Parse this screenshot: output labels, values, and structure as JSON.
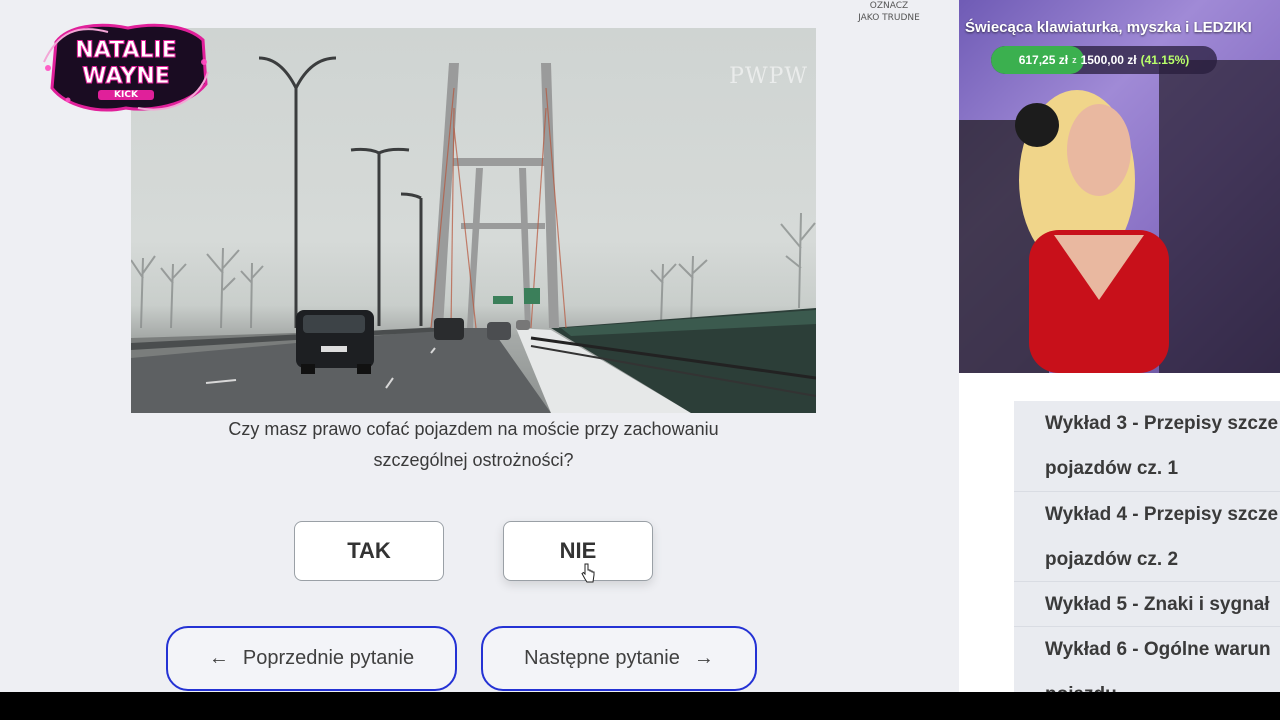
{
  "brand": {
    "name_line1": "NATALIE",
    "name_line2": "WAYNE",
    "platform": "KICK"
  },
  "mark_hard": {
    "line1": "OZNACZ",
    "line2": "JAKO TRUDNE"
  },
  "image": {
    "watermark": "PWPW"
  },
  "question": {
    "line1": "Czy masz prawo cofać pojazdem na moście przy zachowaniu",
    "line2": "szczególnej ostrożności?"
  },
  "answers": {
    "yes": "TAK",
    "no": "NIE"
  },
  "navigation": {
    "prev_arrow": "←",
    "prev_label": "Poprzednie pytanie",
    "next_label": "Następne pytanie",
    "next_arrow": "→"
  },
  "stream_goal": {
    "title": "Świecąca klawiaturka, myszka i LEDZIKI",
    "current": "617,25 zł",
    "of": "z",
    "target": "1500,00 zł",
    "percent_label": "(41.15%)",
    "progress": 0.4115,
    "fill_color": "#3bb04f"
  },
  "lectures": [
    {
      "line1": "Wykład 3 - Przepisy szcze",
      "line2": "pojazdów cz. 1"
    },
    {
      "line1": "Wykład 4 - Przepisy szcze",
      "line2": "pojazdów cz. 2"
    },
    {
      "line1": "Wykład 5 - Znaki i sygnał",
      "line2": ""
    },
    {
      "line1": "Wykład 6 - Ogólne warun",
      "line2": "pojazdu"
    }
  ],
  "colors": {
    "nav_border": "#2432d4",
    "logo_pink": "#e0209a",
    "background": "#eeeff3"
  }
}
